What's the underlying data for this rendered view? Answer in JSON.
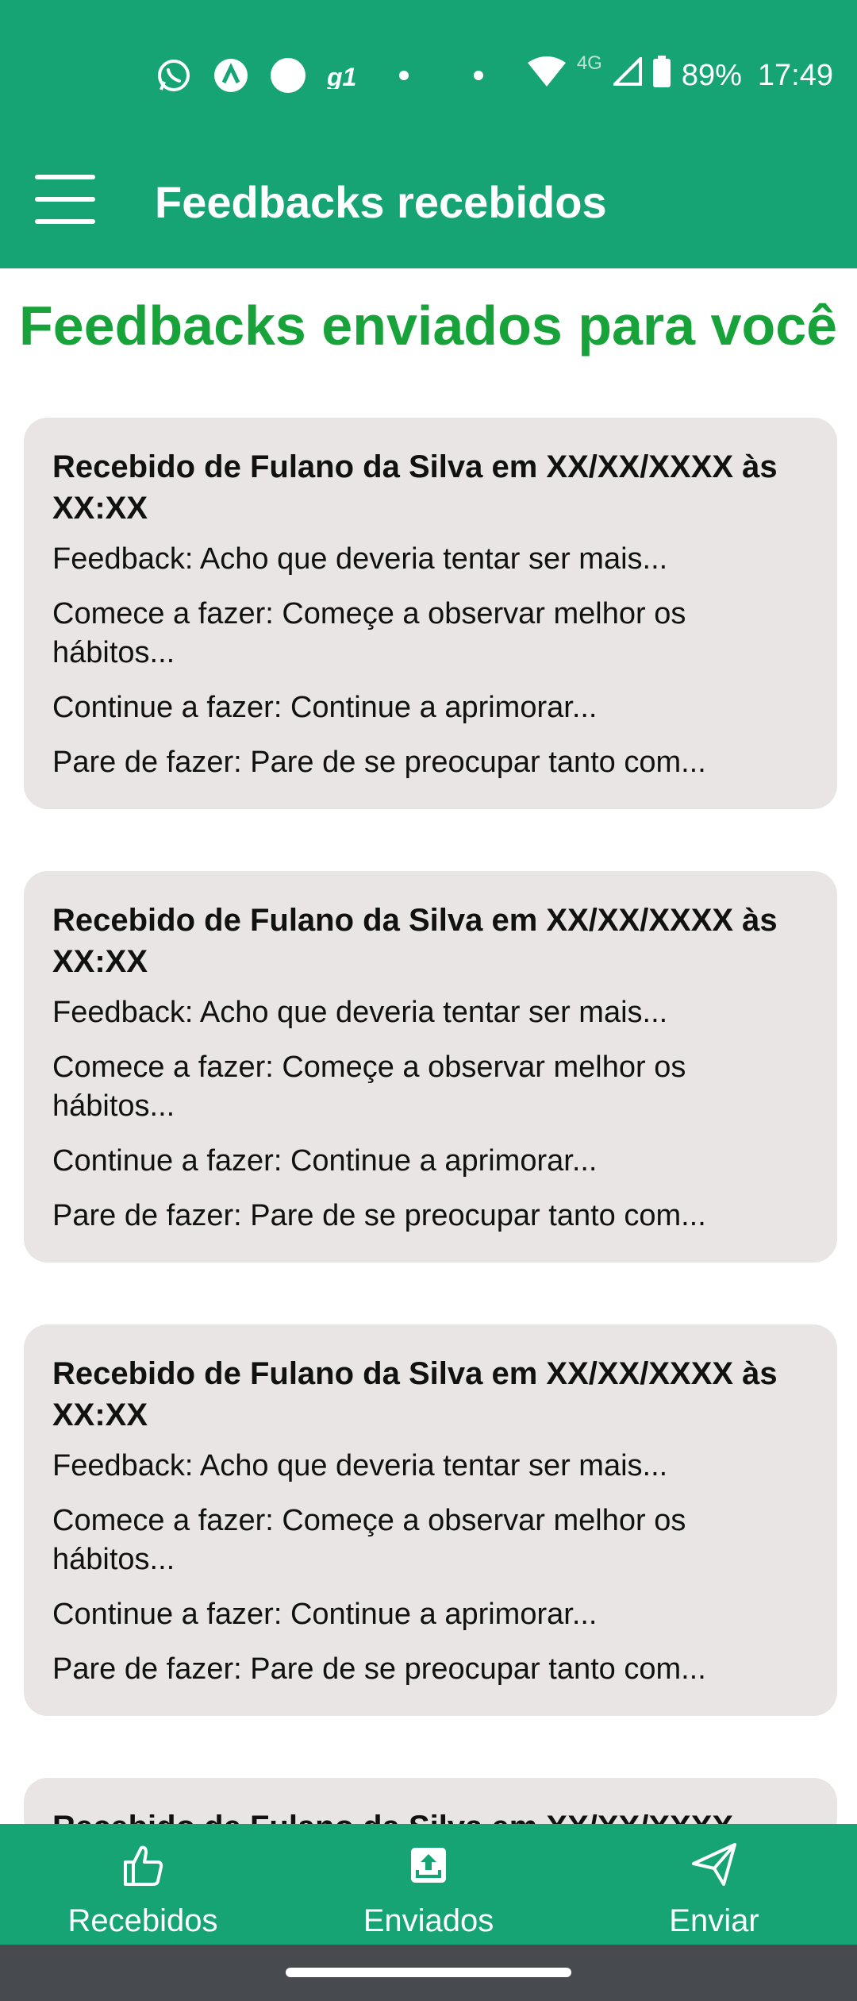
{
  "status_bar": {
    "battery_percent": "89%",
    "time": "17:49",
    "network": "4G",
    "icons": [
      "whatsapp-icon",
      "app-icon",
      "circle-icon",
      "g1-icon",
      "dot-icon",
      "dot-icon",
      "wifi-icon",
      "signal-icon",
      "battery-icon"
    ]
  },
  "app_bar": {
    "title": "Feedbacks recebidos",
    "menu_icon": "menu-icon"
  },
  "page": {
    "heading": "Feedbacks enviados para você"
  },
  "cards": [
    {
      "title": "Recebido de Fulano da Silva em XX/XX/XXXX às XX:XX",
      "feedback": "Feedback: Acho que deveria tentar ser mais...",
      "start": "Comece a fazer: Começe a observar melhor os hábitos...",
      "continue": "Continue a fazer: Continue a aprimorar...",
      "stop": "Pare de fazer: Pare de se preocupar tanto com..."
    },
    {
      "title": "Recebido de Fulano da Silva em XX/XX/XXXX às XX:XX",
      "feedback": "Feedback: Acho que deveria tentar ser mais...",
      "start": "Comece a fazer: Começe a observar melhor os hábitos...",
      "continue": "Continue a fazer: Continue a aprimorar...",
      "stop": "Pare de fazer: Pare de se preocupar tanto com..."
    },
    {
      "title": "Recebido de Fulano da Silva em XX/XX/XXXX às XX:XX",
      "feedback": "Feedback: Acho que deveria tentar ser mais...",
      "start": "Comece a fazer: Começe a observar melhor os hábitos...",
      "continue": "Continue a fazer: Continue a aprimorar...",
      "stop": "Pare de fazer: Pare de se preocupar tanto com..."
    },
    {
      "title": "Recebido de Fulano da Silva em XX/XX/XXXX"
    }
  ],
  "bottom_nav": [
    {
      "label": "Recebidos",
      "icon": "thumbs-up-icon"
    },
    {
      "label": "Enviados",
      "icon": "upload-box-icon"
    },
    {
      "label": "Enviar",
      "icon": "send-icon"
    }
  ],
  "colors": {
    "primary": "#17a474",
    "heading_green": "#17a33a",
    "card_bg": "#e8e5e4",
    "system_nav": "#474b50"
  }
}
